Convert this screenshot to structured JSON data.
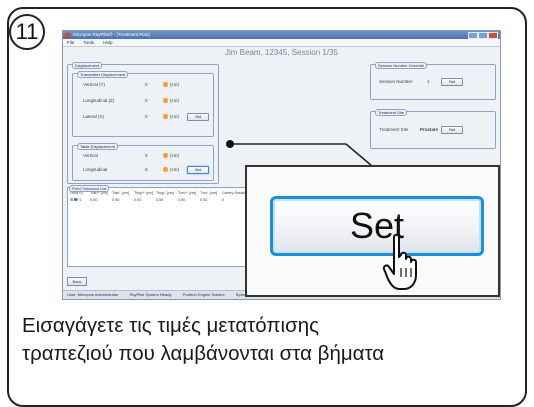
{
  "step": {
    "number": "11"
  },
  "window": {
    "title": "Micropos RayPilot® - [Treatment Plan]",
    "menu": [
      "File",
      "Tools",
      "Help"
    ],
    "session_title": "Jim Beam, 12345, Session 1/35"
  },
  "displacement": {
    "group_label": "Displacement",
    "transmitter": {
      "label": "Transmitter Displacement",
      "rows": [
        {
          "name": "Vertical (Y)",
          "value": "0",
          "unit": "(cm)"
        },
        {
          "name": "Longitudinal (Z)",
          "value": "0",
          "unit": "(cm)"
        },
        {
          "name": "Lateral (X)",
          "value": "0",
          "unit": "(cm)"
        }
      ],
      "set_label": "Set"
    },
    "table": {
      "label": "Table Displacement",
      "rows": [
        {
          "name": "Vertical",
          "value": "0",
          "unit": "(cm)"
        },
        {
          "name": "Longitudinal",
          "value": "0",
          "unit": "(cm)"
        }
      ],
      "set_label": "Set"
    }
  },
  "session_number": {
    "group_label": "Session Number Override",
    "label": "Session Number",
    "value": "1",
    "set_label": "Set"
  },
  "treatment_site": {
    "group_label": "Treatment Site",
    "label": "Treatment Site",
    "value": "Prostate",
    "set_label": "Set"
  },
  "tolerance": {
    "group_label": "Field Tolerance List",
    "headers": [
      "Field ID",
      "Tlat/+ [cm]",
      "Tlat/- [cm]",
      "Tlng/+ [cm]",
      "Tlng/- [cm]",
      "Tvrt/+ [cm]",
      "Tvrt/- [cm]",
      "Gantry Rotation",
      "Hb"
    ],
    "row": [
      "F1",
      "0.50",
      "0.50",
      "0.50",
      "0.50",
      "0.50",
      "0.50",
      "0"
    ]
  },
  "back_label": "Back",
  "status": [
    "User: Micropos Administrator",
    "RayPilot System Ready",
    "Position Engine Started",
    "System Mode: Tre"
  ],
  "zoom": {
    "set_label": "Set"
  },
  "caption": {
    "line1": "Εισαγάγετε τις τιμές μετατόπισης",
    "line2": "τραπεζιού που λαμβάνονται στα βήματα"
  },
  "colors": {
    "accent": "#1f8fd4",
    "warning_dot": "#f2a32b",
    "titlebar": "#5a7fb8"
  }
}
